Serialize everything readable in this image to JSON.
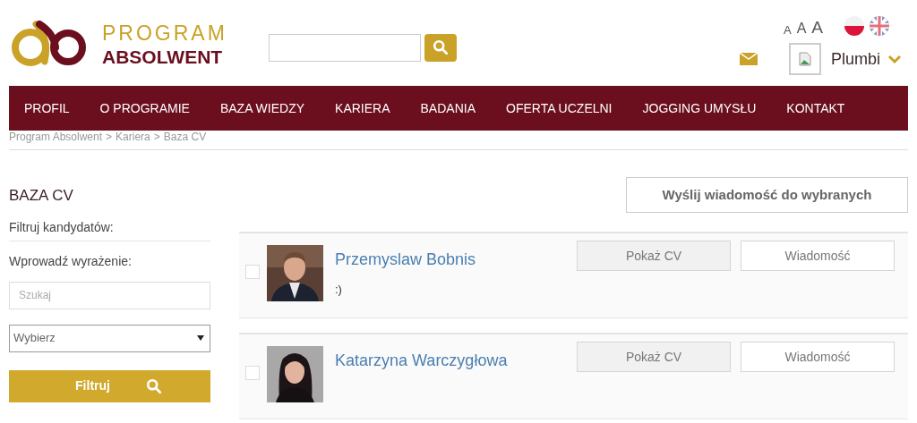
{
  "logo": {
    "line1": "PROGRAM",
    "line2": "ABSOLWENT"
  },
  "font_sizes": [
    "A",
    "A",
    "A"
  ],
  "user": {
    "name": "Plumbi"
  },
  "nav": [
    "PROFIL",
    "O PROGRAMIE",
    "BAZA WIEDZY",
    "KARIERA",
    "BADANIA",
    "OFERTA UCZELNI",
    "JOGGING UMYSŁU",
    "KONTAKT"
  ],
  "breadcrumb": {
    "separator": ">",
    "items": [
      "Program Absolwent",
      "Kariera",
      "Baza CV"
    ]
  },
  "sidebar": {
    "title": "BAZA CV",
    "filter_label": "Filtruj kandydatów:",
    "expression_label": "Wprowadź wyrażenie:",
    "search_placeholder": "Szukaj",
    "select_value": "Wybierz",
    "filter_button": "Filtruj"
  },
  "send_button": "Wyślij wiadomość do wybranych",
  "candidates": [
    {
      "name": "Przemyslaw Bobnis",
      "note": ":)",
      "checked": false,
      "show_cv": "Pokaż CV",
      "message": "Wiadomość",
      "kind": "man"
    },
    {
      "name": "Katarzyna Warczygłowa",
      "checked": false,
      "show_cv": "Pokaż CV",
      "message": "Wiadomość",
      "kind": "woman"
    }
  ]
}
